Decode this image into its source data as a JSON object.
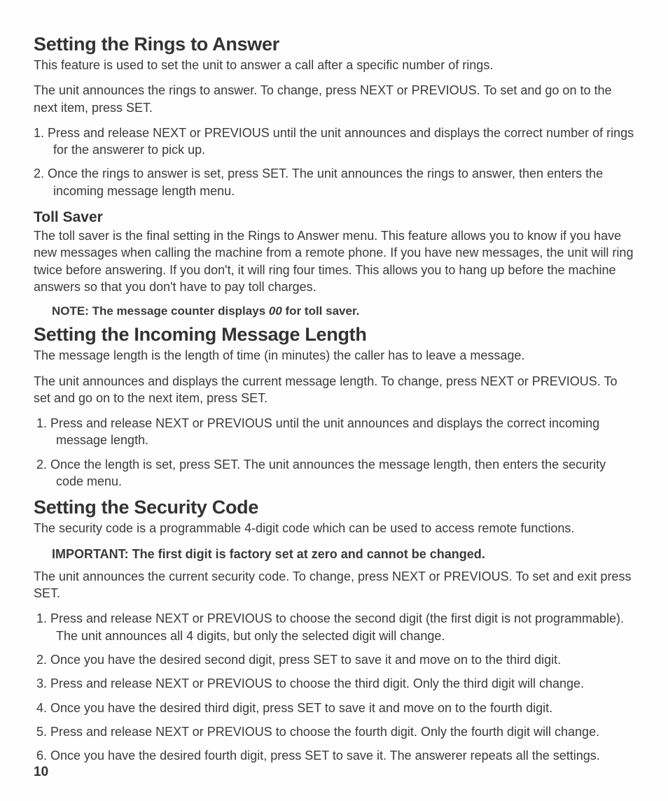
{
  "section1": {
    "heading": "Setting the Rings to Answer",
    "p1": "This feature is used to set the unit to answer a call after a specific number of rings.",
    "p2": "The unit announces the rings to answer. To change, press NEXT or PREVIOUS. To set and go on to the next item, press SET.",
    "list": [
      "1. Press and release NEXT or PREVIOUS until the unit announces and displays the correct number of rings for the answerer to pick up.",
      "2. Once the rings to answer is set, press SET. The unit announces the rings to answer, then enters the incoming message length menu."
    ],
    "sub": {
      "heading": "Toll Saver",
      "p1": "The toll saver is the final setting in the Rings to Answer menu. This feature allows you to know if you have new messages when calling the machine from a remote phone. If you have new messages, the unit will ring twice before answering.  If you don't, it will ring four times. This allows you to hang up before the machine answers so that you don't have to pay toll charges.",
      "note_prefix": "NOTE: The message counter displays ",
      "note_italic": "00",
      "note_suffix": "  for toll saver."
    }
  },
  "section2": {
    "heading": "Setting the Incoming Message Length",
    "p1": "The message length is the length of time (in minutes) the caller has to leave a message.",
    "p2": "The unit announces and displays the current message length. To change, press NEXT or PREVIOUS. To set and go on to the next item, press SET.",
    "list": [
      "1.  Press and release NEXT or PREVIOUS until the unit announces and displays the correct incoming message length.",
      "2.  Once the length is set, press SET. The unit announces the message length, then enters the security code menu."
    ]
  },
  "section3": {
    "heading": "Setting the Security Code",
    "p1": "The security code is a programmable 4-digit code which can be used to access remote functions.",
    "important": "IMPORTANT: The first digit is factory set at zero and cannot be changed.",
    "p2": "The unit announces the current security code. To change, press NEXT or PREVIOUS. To set and exit press SET.",
    "list": [
      "1.  Press and release NEXT or PREVIOUS to choose the second digit (the first digit is not programmable). The unit announces all 4 digits, but only the selected digit will change.",
      "2.  Once you have the desired second digit, press SET to save it and move on to the third digit.",
      "3.  Press and release NEXT or PREVIOUS to choose the third digit. Only the third digit will change.",
      "4.  Once you have the desired third digit, press SET to save it and move on to the fourth digit.",
      "5.  Press and release NEXT or PREVIOUS to choose the fourth digit. Only the fourth digit will change.",
      "6.  Once you have the desired fourth digit, press SET to save it. The answerer repeats all the settings."
    ]
  },
  "page_number": "10"
}
